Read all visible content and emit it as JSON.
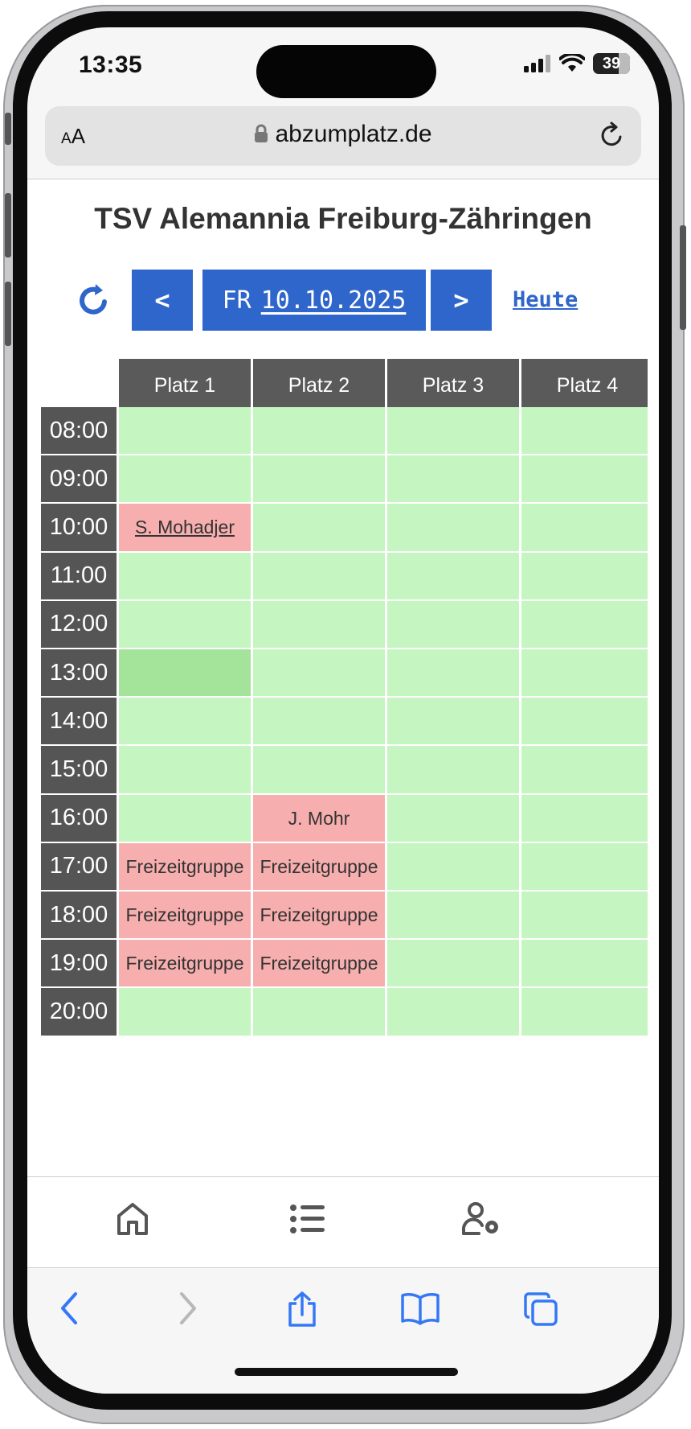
{
  "status_bar": {
    "time": "13:35",
    "battery": "39"
  },
  "browser": {
    "text_size_label_small": "A",
    "text_size_label_large": "A",
    "url": "abzumplatz.de"
  },
  "page": {
    "title": "TSV Alemannia Freiburg-Zähringen",
    "nav": {
      "prev_label": "<",
      "next_label": ">",
      "weekday": "FR",
      "date": "10.10.2025",
      "today_label": "Heute"
    },
    "courts": [
      "Platz 1",
      "Platz 2",
      "Platz 3",
      "Platz 4"
    ],
    "time_slots": [
      "08:00",
      "09:00",
      "10:00",
      "11:00",
      "12:00",
      "13:00",
      "14:00",
      "15:00",
      "16:00",
      "17:00",
      "18:00",
      "19:00",
      "20:00"
    ],
    "bookings": [
      {
        "slot": 2,
        "court": 0,
        "label": "S. Mohadjer",
        "link": true
      },
      {
        "slot": 8,
        "court": 1,
        "label": "J. Mohr",
        "link": false
      },
      {
        "slot": 9,
        "court": 0,
        "label": "Freizeitgruppe",
        "link": false
      },
      {
        "slot": 9,
        "court": 1,
        "label": "Freizeitgruppe",
        "link": false
      },
      {
        "slot": 10,
        "court": 0,
        "label": "Freizeitgruppe",
        "link": false
      },
      {
        "slot": 10,
        "court": 1,
        "label": "Freizeitgruppe",
        "link": false
      },
      {
        "slot": 11,
        "court": 0,
        "label": "Freizeitgruppe",
        "link": false
      },
      {
        "slot": 11,
        "court": 1,
        "label": "Freizeitgruppe",
        "link": false
      }
    ],
    "selected_cell": {
      "slot": 5,
      "court": 0
    }
  },
  "app_nav": {
    "items": [
      "home-icon",
      "list-icon",
      "user-settings-icon"
    ]
  },
  "safari_toolbar": {
    "items": [
      "back-icon",
      "forward-icon",
      "share-icon",
      "bookmarks-icon",
      "tabs-icon"
    ]
  },
  "colors": {
    "accent": "#2f66cc",
    "free": "#c5f5c0",
    "booked": "#f7aeae",
    "selected": "#a3e39a",
    "header": "#5a5a5a"
  }
}
